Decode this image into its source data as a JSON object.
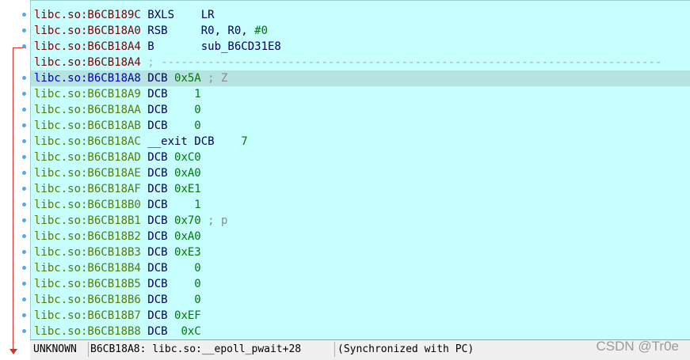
{
  "listing": {
    "rows": [
      {
        "addr": "libc.so:B6CB189C",
        "kind": "code",
        "text": " BXLS    LR"
      },
      {
        "addr": "libc.so:B6CB18A0",
        "kind": "code",
        "text": " RSB     R0, R0, #0"
      },
      {
        "addr": "libc.so:B6CB18A4",
        "kind": "code",
        "text": " B       sub_B6CD31E8"
      },
      {
        "addr": "libc.so:B6CB18A4",
        "kind": "code",
        "text": " ; ---------------------------------------------------------------------------"
      },
      {
        "addr": "libc.so:B6CB18A8",
        "kind": "hl",
        "text": " DCB 0x5A ; Z"
      },
      {
        "addr": "libc.so:B6CB18A9",
        "kind": "data",
        "text": " DCB    1"
      },
      {
        "addr": "libc.so:B6CB18AA",
        "kind": "data",
        "text": " DCB    0"
      },
      {
        "addr": "libc.so:B6CB18AB",
        "kind": "data",
        "text": " DCB    0"
      },
      {
        "addr": "libc.so:B6CB18AC",
        "kind": "data",
        "text": " __exit DCB    7"
      },
      {
        "addr": "libc.so:B6CB18AD",
        "kind": "data",
        "text": " DCB 0xC0"
      },
      {
        "addr": "libc.so:B6CB18AE",
        "kind": "data",
        "text": " DCB 0xA0"
      },
      {
        "addr": "libc.so:B6CB18AF",
        "kind": "data",
        "text": " DCB 0xE1"
      },
      {
        "addr": "libc.so:B6CB18B0",
        "kind": "data",
        "text": " DCB    1"
      },
      {
        "addr": "libc.so:B6CB18B1",
        "kind": "data",
        "text": " DCB 0x70 ; p"
      },
      {
        "addr": "libc.so:B6CB18B2",
        "kind": "data",
        "text": " DCB 0xA0"
      },
      {
        "addr": "libc.so:B6CB18B3",
        "kind": "data",
        "text": " DCB 0xE3"
      },
      {
        "addr": "libc.so:B6CB18B4",
        "kind": "data",
        "text": " DCB    0"
      },
      {
        "addr": "libc.so:B6CB18B5",
        "kind": "data",
        "text": " DCB    0"
      },
      {
        "addr": "libc.so:B6CB18B6",
        "kind": "data",
        "text": " DCB    0"
      },
      {
        "addr": "libc.so:B6CB18B7",
        "kind": "data",
        "text": " DCB 0xEF"
      },
      {
        "addr": "libc.so:B6CB18B8",
        "kind": "data",
        "text": " DCB  0xC"
      }
    ]
  },
  "status_bar": {
    "mode": "UNKNOWN",
    "location": "B6CB18A8: libc.so:__epoll_pwait+28",
    "sync": "(Synchronized with PC)"
  },
  "watermark": "CSDN @Tr0e",
  "colors": {
    "listing_bg": "#c6fffe",
    "highlight_row": "#b6e3e2",
    "code_address": "#7f0000",
    "data_address": "#5a7a00",
    "jump_arrow": "#d4342c"
  }
}
